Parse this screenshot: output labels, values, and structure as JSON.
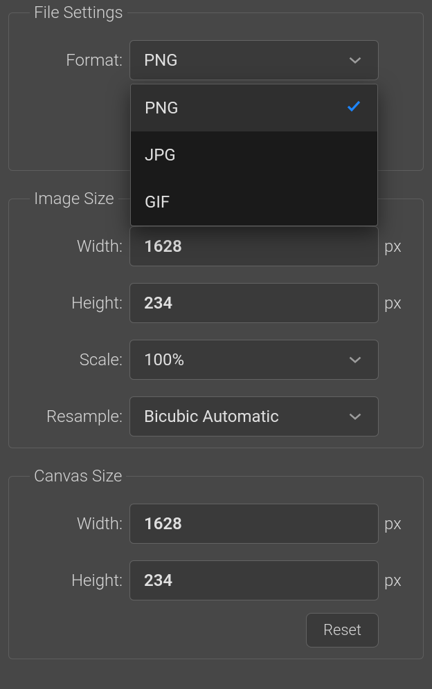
{
  "fileSettings": {
    "legend": "File Settings",
    "formatLabel": "Format:",
    "formatValue": "PNG",
    "formatOptions": [
      "PNG",
      "JPG",
      "GIF"
    ],
    "formatSelectedIndex": 0
  },
  "imageSize": {
    "legend": "Image Size",
    "widthLabel": "Width:",
    "widthValue": "1628",
    "heightLabel": "Height:",
    "heightValue": "234",
    "scaleLabel": "Scale:",
    "scaleValue": "100%",
    "resampleLabel": "Resample:",
    "resampleValue": "Bicubic Automatic",
    "unitPx": "px"
  },
  "canvasSize": {
    "legend": "Canvas Size",
    "widthLabel": "Width:",
    "widthValue": "1628",
    "heightLabel": "Height:",
    "heightValue": "234",
    "unitPx": "px",
    "resetLabel": "Reset"
  }
}
